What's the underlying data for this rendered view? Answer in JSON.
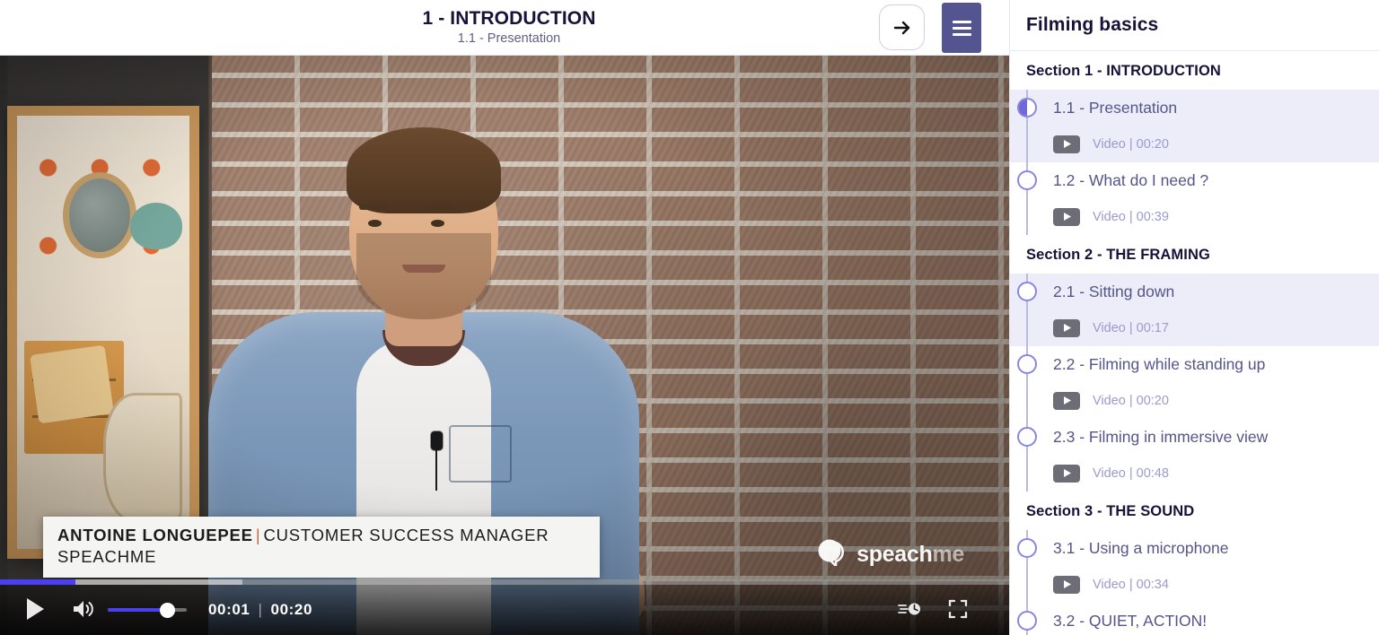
{
  "header": {
    "title": "1 - INTRODUCTION",
    "subtitle": "1.1 - Presentation",
    "next_icon": "arrow-right-icon",
    "menu_icon": "hamburger-menu-icon",
    "accent_color": "#545490",
    "border_color": "#cfcdf2"
  },
  "player": {
    "current_time": "00:01",
    "total_time": "00:20",
    "time_separator": "|",
    "progress_percent": 7.5,
    "buffered_percent": 24,
    "volume_percent": 72,
    "play_icon": "play-icon",
    "volume_icon": "volume-icon",
    "speed_icon": "playback-speed-icon",
    "fullscreen_icon": "fullscreen-icon",
    "accent_color": "#4b3ff0"
  },
  "overlay": {
    "speaker_name": "ANTOINE LONGUEPEE",
    "separator": "|",
    "speaker_role": "CUSTOMER SUCCESS MANAGER",
    "speaker_company": "SPEACHME",
    "separator_color": "#c4693a"
  },
  "watermark": {
    "logo_icon": "speech-bubble-icon",
    "text_strong": "speach",
    "text_light": "me"
  },
  "sidebar": {
    "title": "Filming basics",
    "sections": [
      {
        "heading": "Section 1 - INTRODUCTION",
        "items": [
          {
            "title": "1.1 - Presentation",
            "meta": "Video | 00:20",
            "state": "in-progress",
            "active": true,
            "play_icon": "play-icon"
          },
          {
            "title": "1.2 - What do I need ?",
            "meta": "Video | 00:39",
            "state": "not-started",
            "active": false,
            "play_icon": "play-icon"
          }
        ]
      },
      {
        "heading": "Section 2 - THE FRAMING",
        "items": [
          {
            "title": "2.1 - Sitting down",
            "meta": "Video | 00:17",
            "state": "not-started",
            "active": true,
            "play_icon": "play-icon"
          },
          {
            "title": "2.2 - Filming while standing up",
            "meta": "Video | 00:20",
            "state": "not-started",
            "active": false,
            "play_icon": "play-icon"
          },
          {
            "title": "2.3 - Filming in immersive view",
            "meta": "Video | 00:48",
            "state": "not-started",
            "active": false,
            "play_icon": "play-icon"
          }
        ]
      },
      {
        "heading": "Section 3 - THE SOUND",
        "items": [
          {
            "title": "3.1 - Using a microphone",
            "meta": "Video | 00:34",
            "state": "not-started",
            "active": false,
            "play_icon": "play-icon"
          },
          {
            "title": "3.2 - QUIET, ACTION!",
            "meta": "",
            "state": "not-started",
            "active": false,
            "play_icon": "play-icon"
          }
        ]
      }
    ]
  }
}
